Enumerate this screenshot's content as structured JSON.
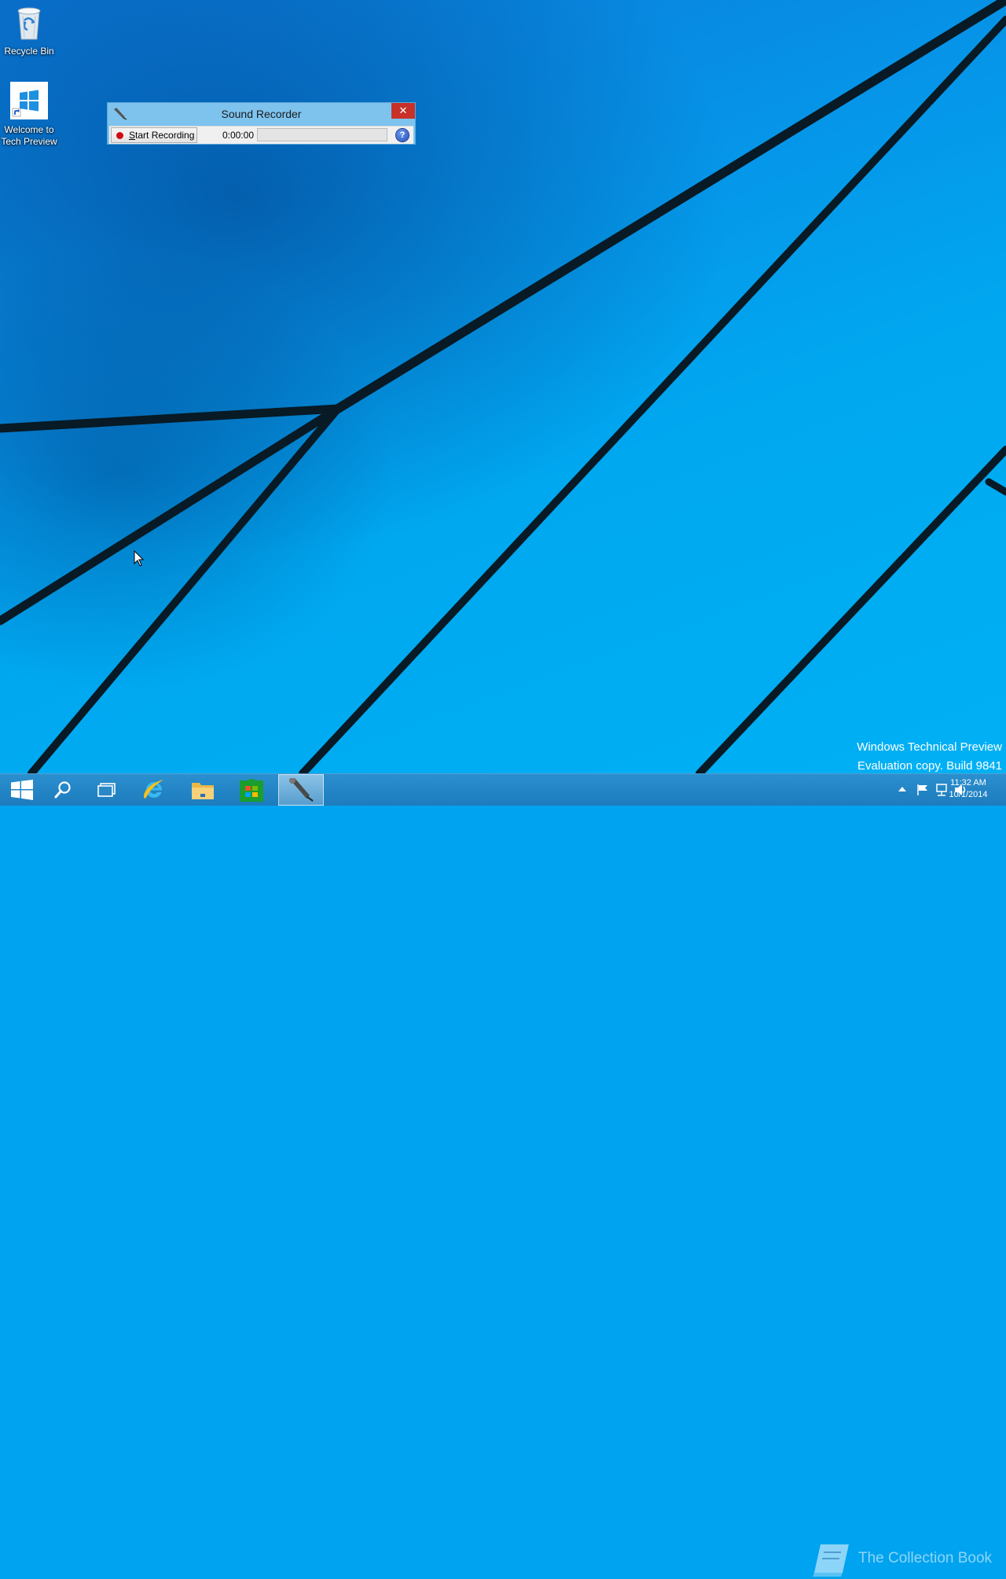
{
  "desktop": {
    "icons": [
      {
        "label": "Recycle Bin"
      },
      {
        "label_line1": "Welcome to",
        "label_line2": "Tech Preview"
      }
    ]
  },
  "sound_recorder": {
    "title": "Sound Recorder",
    "start_button_accel": "S",
    "start_button_rest": "tart Recording",
    "time": "0:00:00",
    "help_label": "?",
    "close_label": "✕"
  },
  "watermark": {
    "line1": "Windows Technical Preview",
    "line2": "Evaluation copy. Build 9841",
    "brand": "The Collection Book"
  },
  "taskbar": {
    "items": [
      "start-icon",
      "search-icon",
      "task-view-icon",
      "internet-explorer-icon",
      "file-explorer-icon",
      "store-icon",
      "sound-recorder-icon"
    ],
    "clock_time": "11:32 AM",
    "clock_date": "10/1/2014"
  },
  "colors": {
    "taskbar": "#1d7cbd",
    "window_frame": "#7dc3ee",
    "close_button": "#c7312a",
    "record_dot": "#d10a10"
  }
}
